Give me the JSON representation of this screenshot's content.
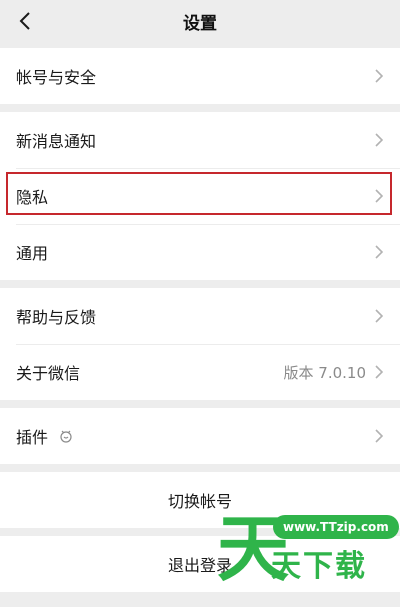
{
  "nav": {
    "title": "设置",
    "back_icon": "chevron-left-icon"
  },
  "groups": {
    "account": {
      "items": [
        {
          "label": "帐号与安全"
        }
      ]
    },
    "general": {
      "items": [
        {
          "label": "新消息通知"
        },
        {
          "label": "隐私"
        },
        {
          "label": "通用"
        }
      ]
    },
    "about": {
      "items": [
        {
          "label": "帮助与反馈"
        },
        {
          "label": "关于微信",
          "value": "版本 7.0.10"
        }
      ]
    },
    "plugins": {
      "items": [
        {
          "label": "插件",
          "icon": "plugin-icon"
        }
      ]
    }
  },
  "actions": {
    "switch_account": "切换帐号",
    "logout": "退出登录"
  },
  "watermark": {
    "big_char": "天",
    "url": "www.TTzip.com",
    "text": "天下载"
  },
  "colors": {
    "background": "#ededed",
    "cell": "#ffffff",
    "highlight_border": "#c6282d",
    "watermark_green": "#2fb44a"
  }
}
